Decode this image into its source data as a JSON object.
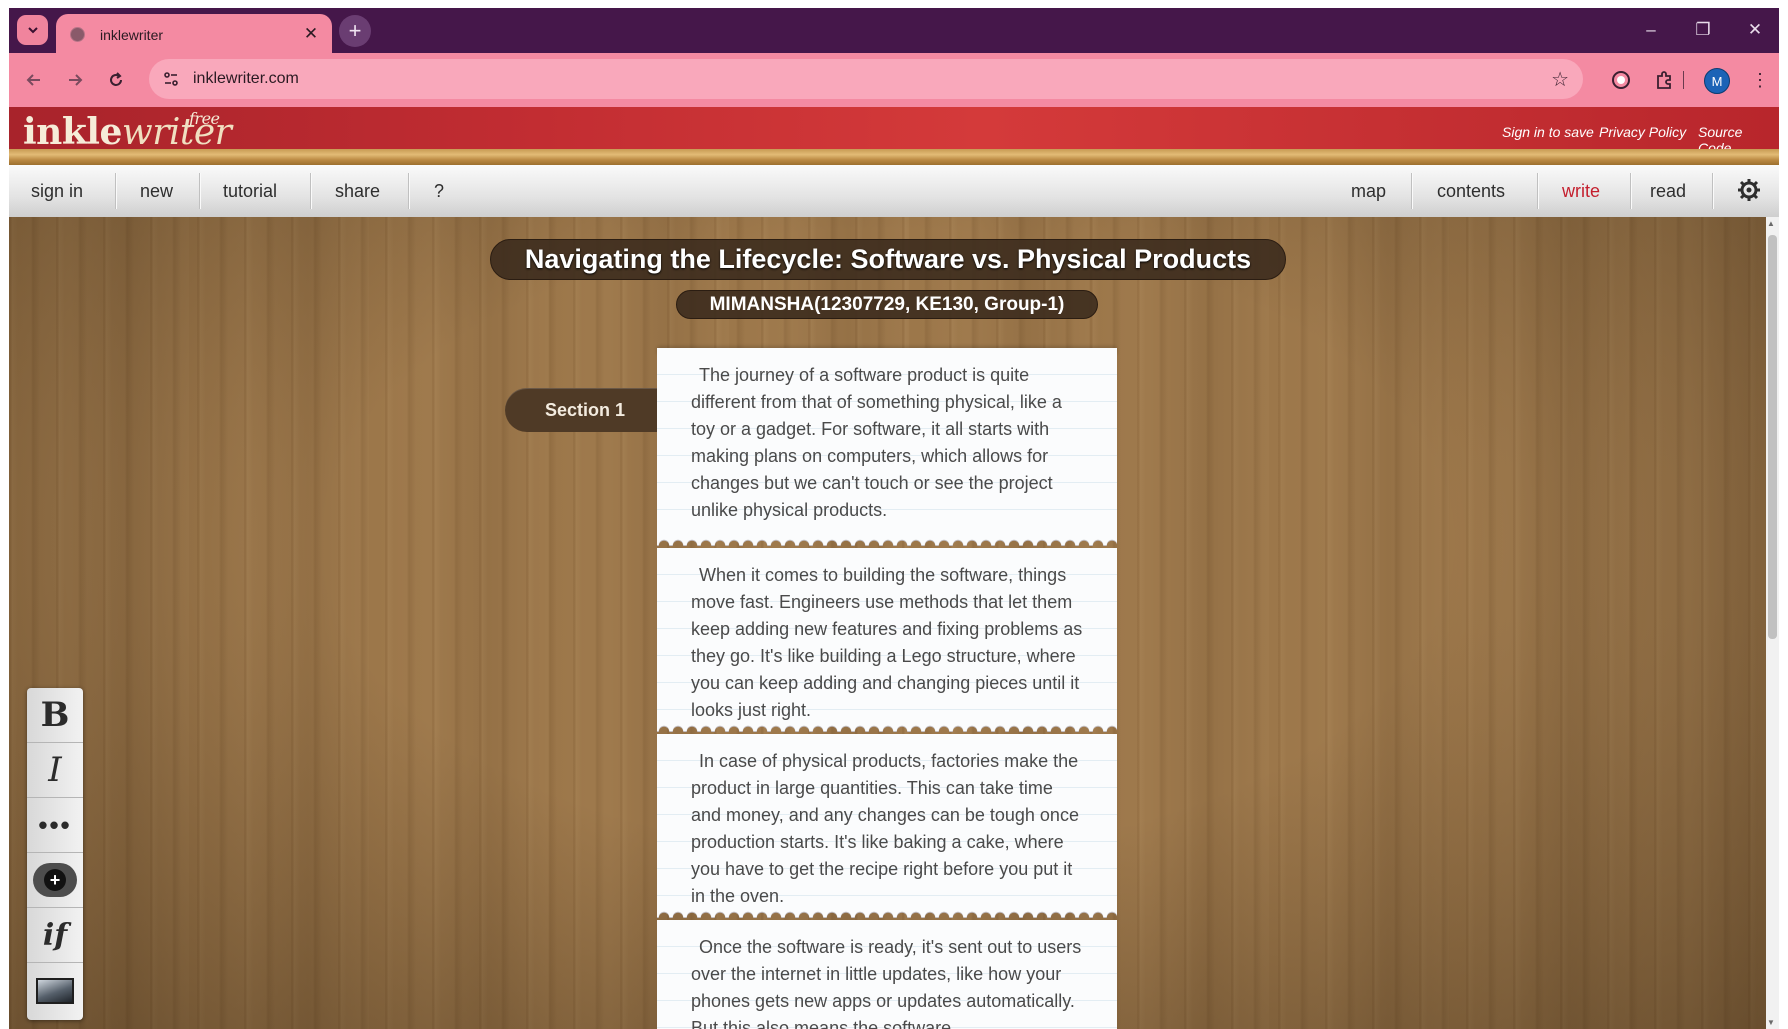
{
  "browser": {
    "tab_title": "inklewriter",
    "tab_close_glyph": "✕",
    "new_tab_glyph": "+",
    "url": "inklewriter.com",
    "avatar_letter": "M",
    "window_controls": [
      "–",
      "❐",
      "✕"
    ]
  },
  "header": {
    "logo_main": "inkle",
    "logo_writer": "writer",
    "logo_free": "free",
    "links": [
      "Sign in to save",
      "Privacy Policy",
      "Source Code"
    ]
  },
  "menu": {
    "left": [
      "sign in",
      "new",
      "tutorial",
      "share",
      "?"
    ],
    "right": [
      "map",
      "contents",
      "write",
      "read"
    ],
    "active": "write",
    "settings_icon": "gear-icon"
  },
  "story": {
    "title": "Navigating the Lifecycle: Software vs. Physical Products",
    "author": "MIMANSHA(12307729, KE130, Group-1)",
    "section_label": "Section 1",
    "paragraphs": [
      "The journey of a software product is quite different from that of something physical, like a toy or a gadget. For software, it all starts with making plans on computers, which allows for changes but we can't touch or see the project unlike physical products.",
      "When it comes to building the software, things move fast. Engineers use methods that let them keep adding new features and fixing problems as they go. It's like building a Lego structure, where you can keep adding and changing pieces until it looks just right.",
      "In case of physical products, factories make the product in large quantities. This can take time and money, and any changes can be tough once production starts. It's like baking a cake, where you have to get the recipe right before you put it in the oven.",
      "Once the software is ready, it's sent out to users over the internet in little updates, like how your phones gets new apps or updates automatically. But this also means the software"
    ]
  },
  "format_toolbar": {
    "bold": "B",
    "italic": "I",
    "more": "•••",
    "add": "+",
    "condition": "if"
  }
}
